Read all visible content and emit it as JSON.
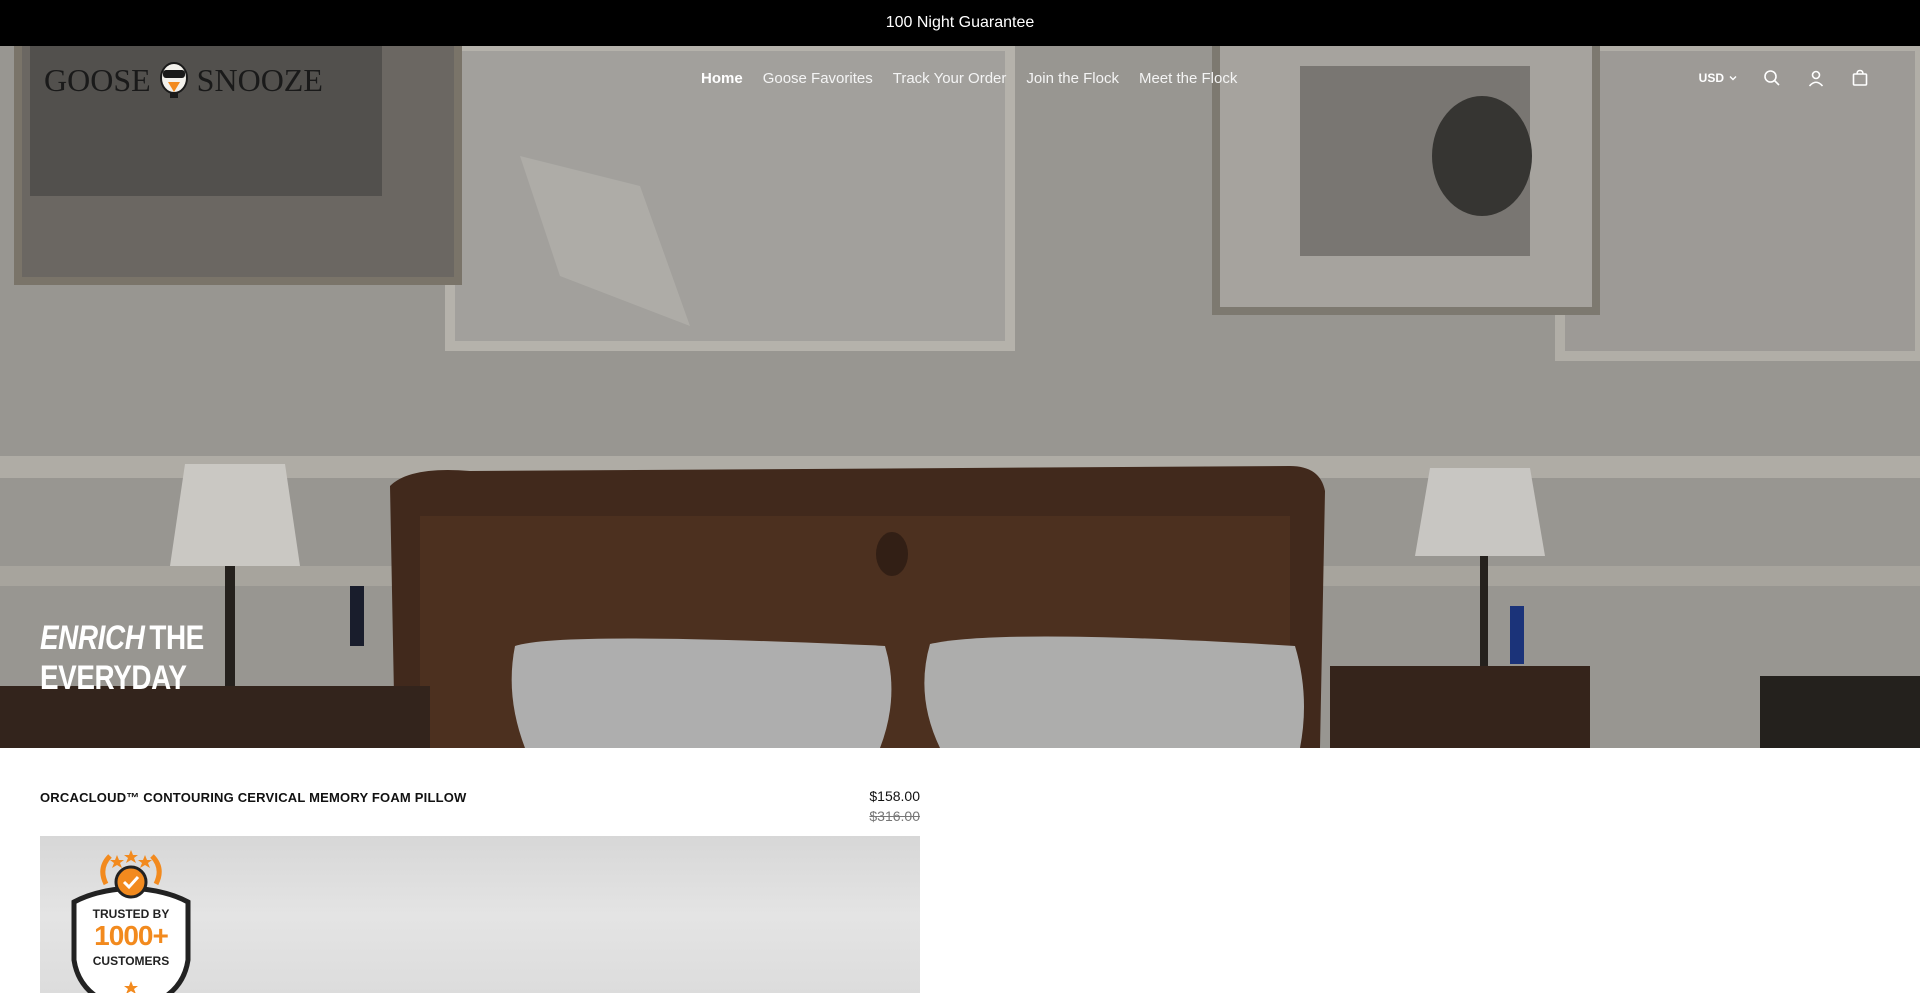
{
  "announcement": "100 Night Guarantee",
  "brand": {
    "name_left": "GOOSE",
    "name_right": "SNOOZE"
  },
  "nav": [
    {
      "label": "Home",
      "active": true
    },
    {
      "label": "Goose Favorites",
      "active": false
    },
    {
      "label": "Track Your Order",
      "active": false
    },
    {
      "label": "Join the Flock",
      "active": false
    },
    {
      "label": "Meet the Flock",
      "active": false
    }
  ],
  "currency": "USD",
  "icons": [
    "chevron-down-icon",
    "search-icon",
    "account-icon",
    "cart-icon"
  ],
  "hero": {
    "headline_em": "ENRICH",
    "headline_rest": "THE",
    "headline_line2": "EVERYDAY"
  },
  "product": {
    "name": "ORCACLOUD™ CONTOURING CERVICAL MEMORY FOAM PILLOW",
    "price": "$158.00",
    "compare_price": "$316.00",
    "badge": {
      "line1": "TRUSTED BY",
      "line2": "1000+",
      "line3": "CUSTOMERS"
    }
  },
  "colors": {
    "announcement_bg": "#000000",
    "badge_orange": "#f28a1e",
    "text_dark": "#111111"
  }
}
